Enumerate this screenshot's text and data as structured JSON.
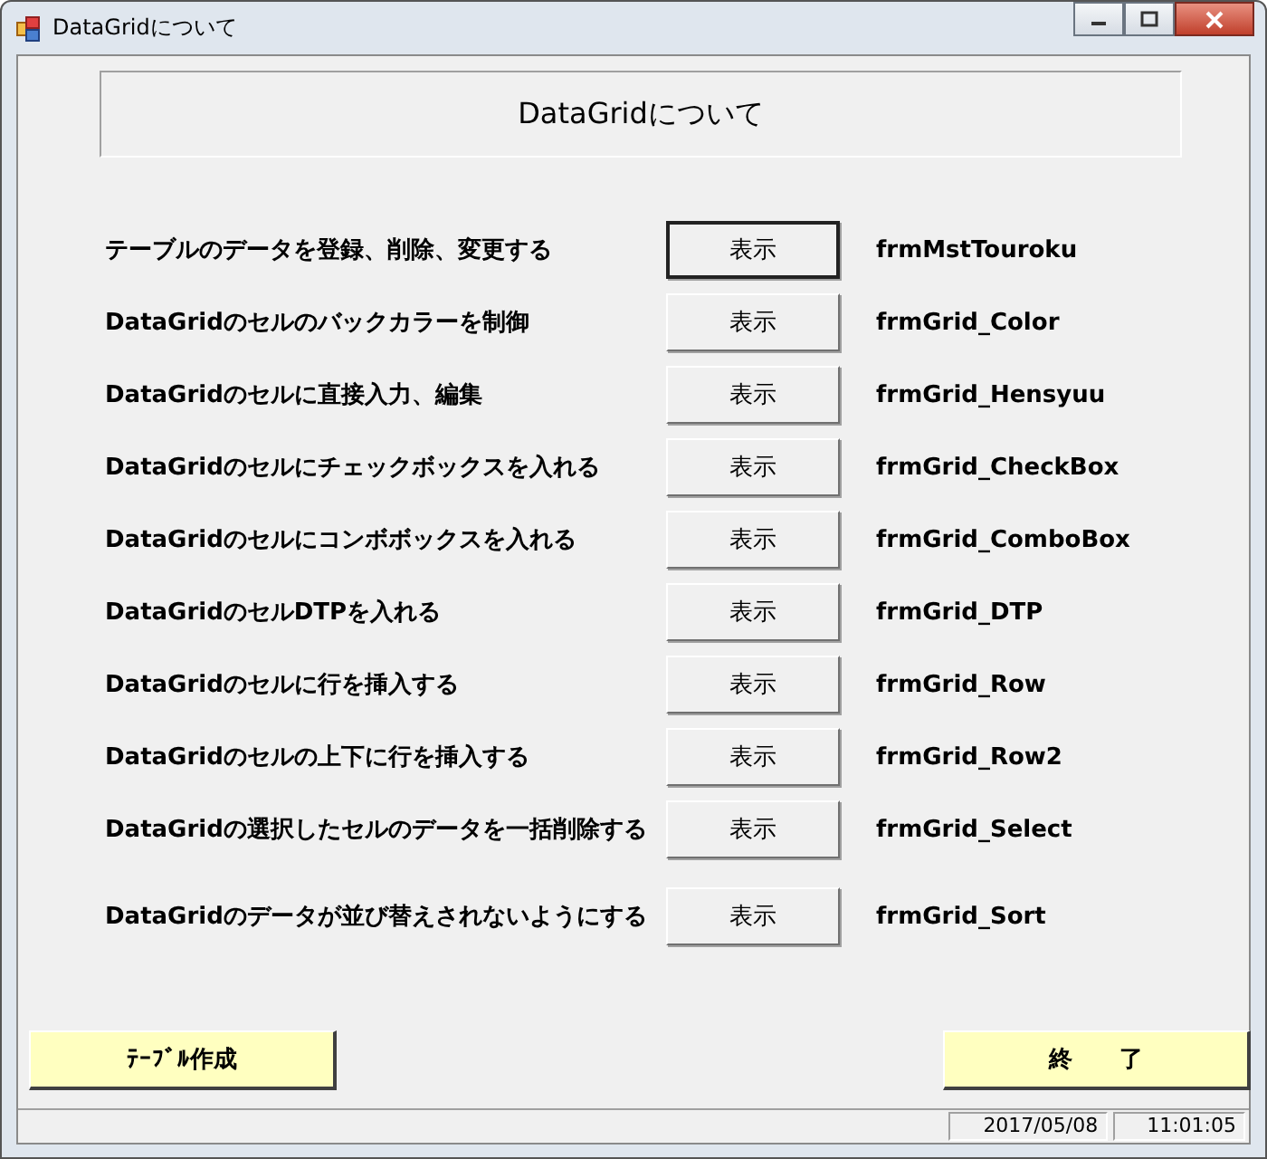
{
  "window": {
    "title": "DataGridについて"
  },
  "header": "DataGridについて",
  "rows": [
    {
      "label": "テーブルのデータを登録、削除、変更する",
      "button": "表示",
      "form": "frmMstTouroku",
      "focused": true
    },
    {
      "label": "DataGridのセルのバックカラーを制御",
      "button": "表示",
      "form": "frmGrid_Color",
      "focused": false
    },
    {
      "label": "DataGridのセルに直接入力、編集",
      "button": "表示",
      "form": "frmGrid_Hensyuu",
      "focused": false
    },
    {
      "label": "DataGridのセルにチェックボックスを入れる",
      "button": "表示",
      "form": "frmGrid_CheckBox",
      "focused": false
    },
    {
      "label": "DataGridのセルにコンボボックスを入れる",
      "button": "表示",
      "form": "frmGrid_ComboBox",
      "focused": false
    },
    {
      "label": "DataGridのセルDTPを入れる",
      "button": "表示",
      "form": "frmGrid_DTP",
      "focused": false
    },
    {
      "label": "DataGridのセルに行を挿入する",
      "button": "表示",
      "form": "frmGrid_Row",
      "focused": false
    },
    {
      "label": "DataGridのセルの上下に行を挿入する",
      "button": "表示",
      "form": "frmGrid_Row2",
      "focused": false
    },
    {
      "label": "DataGridの選択したセルのデータを一括削除する",
      "button": "表示",
      "form": "frmGrid_Select",
      "focused": false
    },
    {
      "label": "DataGridのデータが並び替えされないようにする",
      "button": "表示",
      "form": "frmGrid_Sort",
      "focused": false
    }
  ],
  "buttons": {
    "left": "ﾃｰﾌﾞﾙ作成",
    "right": "終　　了"
  },
  "status_bar": {
    "date": "2017/05/08",
    "time": "11:01:05"
  }
}
